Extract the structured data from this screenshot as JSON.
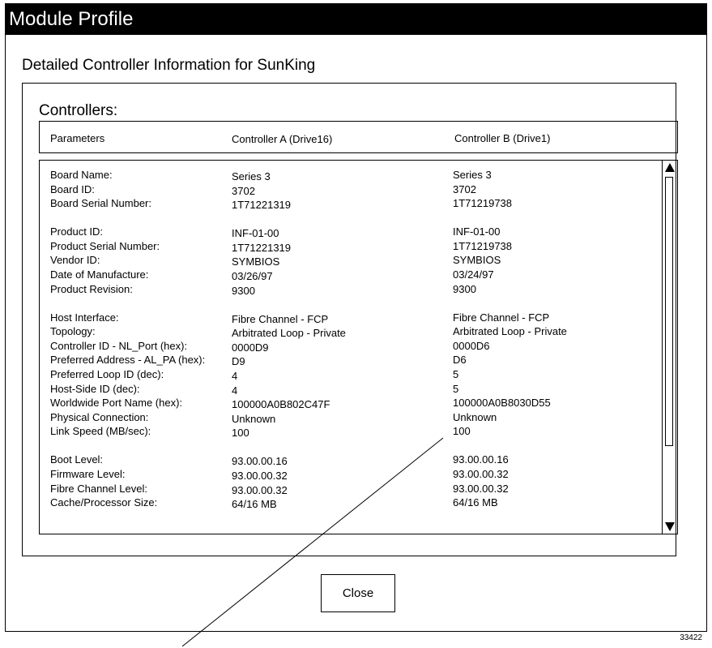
{
  "window": {
    "title": "Module Profile"
  },
  "subtitle": "Detailed Controller Information for SunKing",
  "controllers": {
    "label": "Controllers:",
    "columns": [
      "Parameters",
      "Controller A (Drive16)",
      "Controller B (Drive1)"
    ],
    "rows": [
      [
        "Board Name:",
        "Series 3",
        "Series 3"
      ],
      [
        "Board ID:",
        "3702",
        "3702"
      ],
      [
        "Board Serial Number:",
        "1T71221319",
        "1T71219738"
      ],
      [
        "Product ID:",
        "INF-01-00",
        "INF-01-00"
      ],
      [
        "Product Serial Number:",
        "1T71221319",
        "1T71219738"
      ],
      [
        "Vendor ID:",
        "SYMBIOS",
        "SYMBIOS"
      ],
      [
        "Date of Manufacture:",
        "03/26/97",
        "03/24/97"
      ],
      [
        "Product Revision:",
        "9300",
        "9300"
      ],
      [
        "Host Interface:",
        "Fibre Channel - FCP",
        "Fibre Channel - FCP"
      ],
      [
        "Topology:",
        "Arbitrated Loop - Private",
        "Arbitrated Loop - Private"
      ],
      [
        "Controller ID - NL_Port (hex):",
        "0000D9",
        "0000D6"
      ],
      [
        "Preferred Address - AL_PA (hex):",
        "D9",
        "D6"
      ],
      [
        "Preferred Loop ID (dec):",
        "4",
        "5"
      ],
      [
        "Host-Side ID (dec):",
        "4",
        "5"
      ],
      [
        "Worldwide Port Name (hex):",
        "100000A0B802C47F",
        "100000A0B8030D55"
      ],
      [
        "Physical Connection:",
        "Unknown",
        "Unknown"
      ],
      [
        "Link Speed (MB/sec):",
        "100",
        "100"
      ],
      [
        "Boot Level:",
        "93.00.00.16",
        "93.00.00.16"
      ],
      [
        "Firmware Level:",
        "93.00.00.32",
        "93.00.00.32"
      ],
      [
        "Fibre Channel Level:",
        "93.00.00.32",
        "93.00.00.32"
      ],
      [
        "Cache/Processor Size:",
        "64/16 MB",
        "64/16 MB"
      ]
    ]
  },
  "scrollbar": {
    "up_icon": "arrow-up-icon",
    "down_icon": "arrow-down-icon"
  },
  "close_button": {
    "label": "Close"
  },
  "figure_number": "33422"
}
